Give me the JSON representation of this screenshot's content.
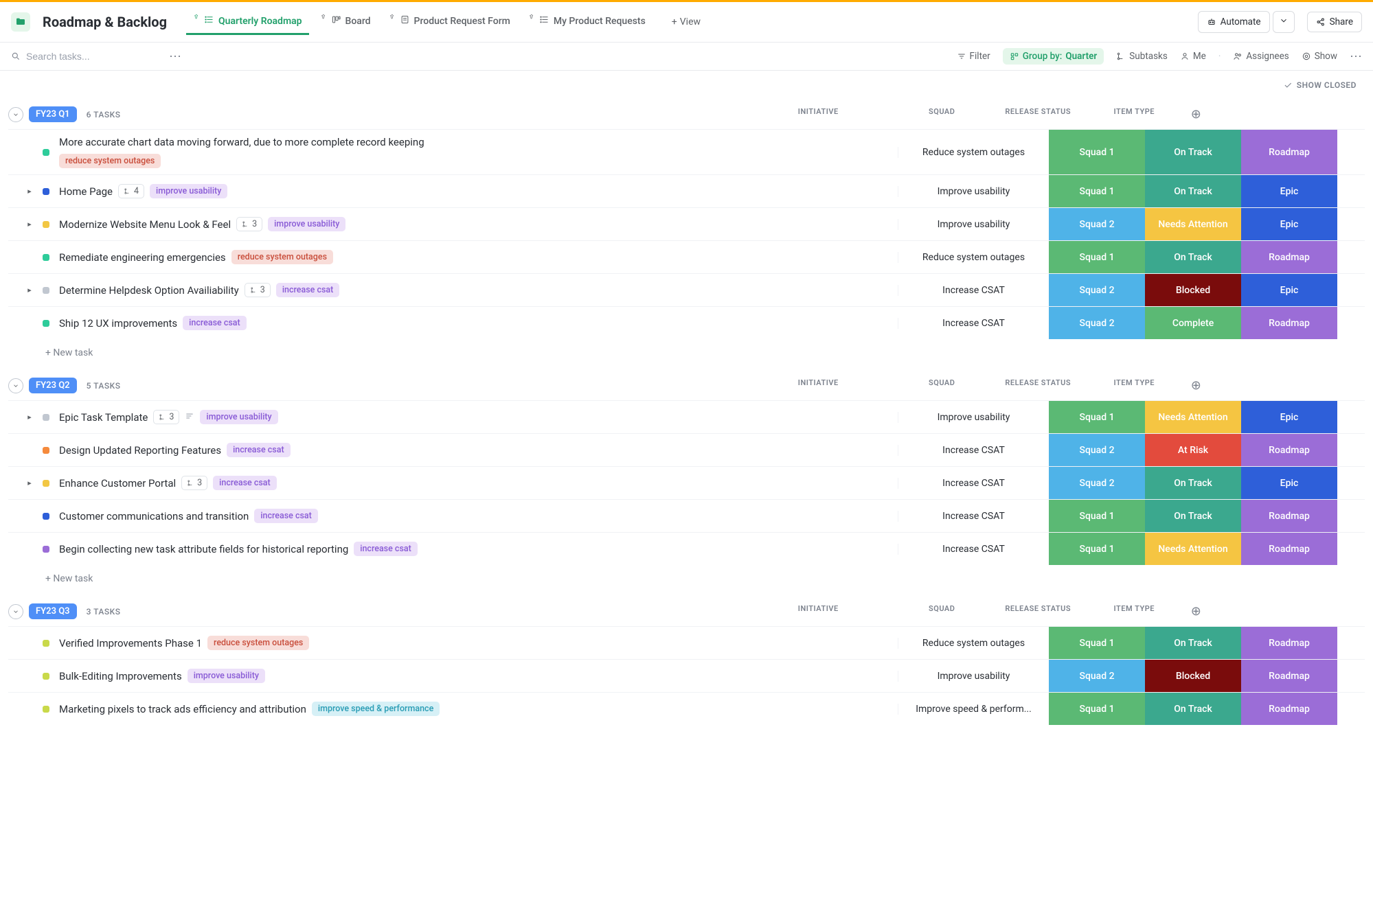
{
  "header": {
    "title": "Roadmap & Backlog",
    "tabs": [
      {
        "label": "Quarterly Roadmap",
        "active": true
      },
      {
        "label": "Board"
      },
      {
        "label": "Product Request Form"
      },
      {
        "label": "My Product Requests"
      }
    ],
    "add_view": "View",
    "automate": "Automate",
    "share": "Share"
  },
  "toolbar": {
    "search_placeholder": "Search tasks...",
    "filter": "Filter",
    "group_by_label": "Group by:",
    "group_by_value": "Quarter",
    "subtasks": "Subtasks",
    "me": "Me",
    "assignees": "Assignees",
    "show": "Show"
  },
  "show_closed": "SHOW CLOSED",
  "col_headers": {
    "initiative": "INITIATIVE",
    "squad": "SQUAD",
    "release_status": "RELEASE STATUS",
    "item_type": "ITEM TYPE"
  },
  "new_task_label": "+ New task",
  "colors": {
    "squad1": "#5bb974",
    "squad2": "#4fb3e8",
    "ontrack": "#3ba88e",
    "needs": "#f5c542",
    "blocked": "#7a0c0c",
    "complete": "#5bb974",
    "atrisk": "#e34b3d",
    "roadmap": "#9b6dd7",
    "epic": "#2e5fd9",
    "sq_teal": "#2ecc9a",
    "sq_blue": "#2e5fd9",
    "sq_yellow": "#f2c744",
    "sq_orange": "#f58a3c",
    "sq_gray": "#c1c7d0",
    "sq_purple": "#9b6dd7",
    "sq_lime": "#c9d94a"
  },
  "groups": [
    {
      "label": "FY23 Q1",
      "count": "6 TASKS",
      "rows": [
        {
          "title": "More accurate chart data moving forward, due to more complete record keeping",
          "tags": [
            {
              "text": "reduce system outages",
              "cls": "tag-reduce"
            }
          ],
          "initiative": "Reduce system outages",
          "squad": {
            "t": "Squad 1",
            "c": "squad1"
          },
          "status": {
            "t": "On Track",
            "c": "ontrack"
          },
          "type": {
            "t": "Roadmap",
            "c": "roadmap"
          },
          "sq": "sq_teal",
          "expand": false,
          "tall": true
        },
        {
          "title": "Home Page",
          "subtasks": "4",
          "tags": [
            {
              "text": "improve usability",
              "cls": "tag-usability"
            }
          ],
          "initiative": "Improve usability",
          "squad": {
            "t": "Squad 1",
            "c": "squad1"
          },
          "status": {
            "t": "On Track",
            "c": "ontrack"
          },
          "type": {
            "t": "Epic",
            "c": "epic"
          },
          "sq": "sq_blue",
          "expand": true
        },
        {
          "title": "Modernize Website Menu Look & Feel",
          "subtasks": "3",
          "tags": [
            {
              "text": "improve usability",
              "cls": "tag-usability"
            }
          ],
          "initiative": "Improve usability",
          "squad": {
            "t": "Squad 2",
            "c": "squad2"
          },
          "status": {
            "t": "Needs Attention",
            "c": "needs"
          },
          "type": {
            "t": "Epic",
            "c": "epic"
          },
          "sq": "sq_yellow",
          "expand": true
        },
        {
          "title": "Remediate engineering emergencies",
          "tags": [
            {
              "text": "reduce system outages",
              "cls": "tag-reduce"
            }
          ],
          "initiative": "Reduce system outages",
          "squad": {
            "t": "Squad 1",
            "c": "squad1"
          },
          "status": {
            "t": "On Track",
            "c": "ontrack"
          },
          "type": {
            "t": "Roadmap",
            "c": "roadmap"
          },
          "sq": "sq_teal",
          "expand": false
        },
        {
          "title": "Determine Helpdesk Option Availiability",
          "subtasks": "3",
          "tags": [
            {
              "text": "increase csat",
              "cls": "tag-csat"
            }
          ],
          "initiative": "Increase CSAT",
          "squad": {
            "t": "Squad 2",
            "c": "squad2"
          },
          "status": {
            "t": "Blocked",
            "c": "blocked"
          },
          "type": {
            "t": "Epic",
            "c": "epic"
          },
          "sq": "sq_gray",
          "expand": true
        },
        {
          "title": "Ship 12 UX improvements",
          "tags": [
            {
              "text": "increase csat",
              "cls": "tag-csat"
            }
          ],
          "initiative": "Increase CSAT",
          "squad": {
            "t": "Squad 2",
            "c": "squad2"
          },
          "status": {
            "t": "Complete",
            "c": "complete"
          },
          "type": {
            "t": "Roadmap",
            "c": "roadmap"
          },
          "sq": "sq_teal",
          "expand": false
        }
      ]
    },
    {
      "label": "FY23 Q2",
      "count": "5 TASKS",
      "rows": [
        {
          "title": "Epic Task Template",
          "subtasks": "3",
          "desc": true,
          "tags": [
            {
              "text": "improve usability",
              "cls": "tag-usability"
            }
          ],
          "initiative": "Improve usability",
          "squad": {
            "t": "Squad 1",
            "c": "squad1"
          },
          "status": {
            "t": "Needs Attention",
            "c": "needs"
          },
          "type": {
            "t": "Epic",
            "c": "epic"
          },
          "sq": "sq_gray",
          "expand": true
        },
        {
          "title": "Design Updated Reporting Features",
          "tags": [
            {
              "text": "increase csat",
              "cls": "tag-csat"
            }
          ],
          "initiative": "Increase CSAT",
          "squad": {
            "t": "Squad 2",
            "c": "squad2"
          },
          "status": {
            "t": "At Risk",
            "c": "atrisk"
          },
          "type": {
            "t": "Roadmap",
            "c": "roadmap"
          },
          "sq": "sq_orange",
          "expand": false
        },
        {
          "title": "Enhance Customer Portal",
          "subtasks": "3",
          "tags": [
            {
              "text": "increase csat",
              "cls": "tag-csat"
            }
          ],
          "initiative": "Increase CSAT",
          "squad": {
            "t": "Squad 2",
            "c": "squad2"
          },
          "status": {
            "t": "On Track",
            "c": "ontrack"
          },
          "type": {
            "t": "Epic",
            "c": "epic"
          },
          "sq": "sq_yellow",
          "expand": true
        },
        {
          "title": "Customer communications and transition",
          "tags": [
            {
              "text": "increase csat",
              "cls": "tag-csat"
            }
          ],
          "initiative": "Increase CSAT",
          "squad": {
            "t": "Squad 1",
            "c": "squad1"
          },
          "status": {
            "t": "On Track",
            "c": "ontrack"
          },
          "type": {
            "t": "Roadmap",
            "c": "roadmap"
          },
          "sq": "sq_blue",
          "expand": false
        },
        {
          "title": "Begin collecting new task attribute fields for historical reporting",
          "tags": [
            {
              "text": "increase csat",
              "cls": "tag-csat"
            }
          ],
          "initiative": "Increase CSAT",
          "squad": {
            "t": "Squad 1",
            "c": "squad1"
          },
          "status": {
            "t": "Needs Attention",
            "c": "needs"
          },
          "type": {
            "t": "Roadmap",
            "c": "roadmap"
          },
          "sq": "sq_purple",
          "expand": false
        }
      ]
    },
    {
      "label": "FY23 Q3",
      "count": "3 TASKS",
      "rows": [
        {
          "title": "Verified Improvements Phase 1",
          "tags": [
            {
              "text": "reduce system outages",
              "cls": "tag-reduce"
            }
          ],
          "initiative": "Reduce system outages",
          "squad": {
            "t": "Squad 1",
            "c": "squad1"
          },
          "status": {
            "t": "On Track",
            "c": "ontrack"
          },
          "type": {
            "t": "Roadmap",
            "c": "roadmap"
          },
          "sq": "sq_lime",
          "expand": false
        },
        {
          "title": "Bulk-Editing Improvements",
          "tags": [
            {
              "text": "improve usability",
              "cls": "tag-usability"
            }
          ],
          "initiative": "Improve usability",
          "squad": {
            "t": "Squad 2",
            "c": "squad2"
          },
          "status": {
            "t": "Blocked",
            "c": "blocked"
          },
          "type": {
            "t": "Roadmap",
            "c": "roadmap"
          },
          "sq": "sq_lime",
          "expand": false
        },
        {
          "title": "Marketing pixels to track ads efficiency and attribution",
          "tags": [
            {
              "text": "improve speed & performance",
              "cls": "tag-speed"
            }
          ],
          "initiative": "Improve speed & perform...",
          "squad": {
            "t": "Squad 1",
            "c": "squad1"
          },
          "status": {
            "t": "On Track",
            "c": "ontrack"
          },
          "type": {
            "t": "Roadmap",
            "c": "roadmap"
          },
          "sq": "sq_lime",
          "expand": false
        }
      ],
      "no_new_task": true
    }
  ]
}
